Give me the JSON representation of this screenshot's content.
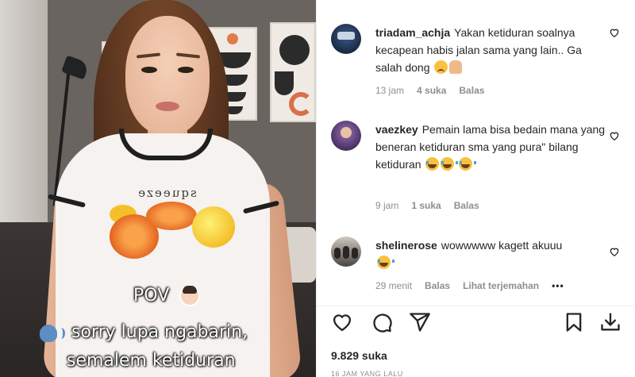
{
  "video": {
    "print_text": "squeeze",
    "overlay": {
      "line1": "POV",
      "line2": "sorry lupa ngabarin,",
      "line3": "semalem ketiduran"
    }
  },
  "comments": [
    {
      "username": "triadam_achja",
      "text": "Yakan ketiduran soalnya kecapean habis jalan sama yang lain.. Ga salah dong",
      "emojis": [
        "sad-face-emoji",
        "praying-hands-emoji"
      ],
      "time": "13 jam",
      "likes": "4 suka",
      "reply": "Balas"
    },
    {
      "username": "vaezkey",
      "text": "Pemain lama bisa bedain mana yang beneran ketiduran sma yang pura\" bilang ketiduran",
      "emojis": [
        "tears-of-joy-emoji",
        "tears-of-joy-emoji",
        "tears-of-joy-emoji"
      ],
      "time": "9 jam",
      "likes": "1 suka",
      "reply": "Balas"
    },
    {
      "username": "shelinerose",
      "text": "wowwwww kagett akuuu",
      "emojis": [
        "tears-of-joy-emoji"
      ],
      "time": "29 menit",
      "reply": "Balas",
      "translate": "Lihat terjemahan",
      "more": "•••"
    }
  ],
  "actions": {
    "icons": [
      "heart-icon",
      "comment-icon",
      "share-icon",
      "bookmark-icon",
      "download-icon"
    ]
  },
  "likes_count": "9.829 suka",
  "timestamp_partial": "16 JAM YANG LALU"
}
